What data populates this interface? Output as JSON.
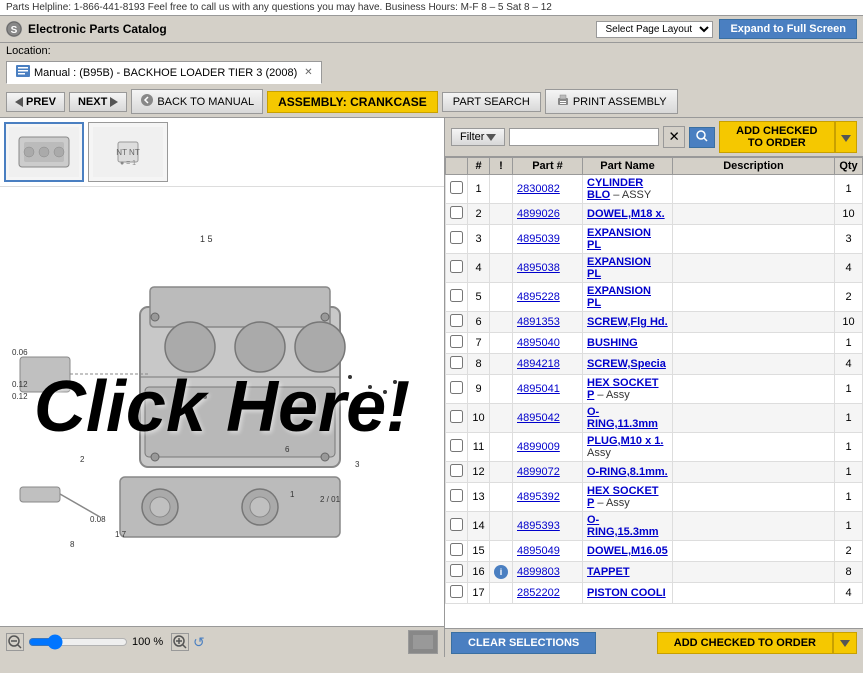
{
  "helpbar": {
    "text": "Parts Helpline: 1-866-441-8193 Feel free to call us with any questions you may have. Business Hours: M-F 8 – 5 Sat 8 – 12"
  },
  "titlebar": {
    "app_name": "Electronic Parts Catalog",
    "page_layout_label": "Select Page Layout",
    "expand_btn": "Expand to Full Screen"
  },
  "location": {
    "label": "Location:"
  },
  "tab": {
    "label": "Manual : (B95B) - BACKHOE LOADER TIER 3 (2008)"
  },
  "toolbar": {
    "prev_label": "PREV",
    "next_label": "NEXT",
    "back_label": "BACK TO MANUAL",
    "assembly_label": "ASSEMBLY: CRANKCASE",
    "part_search_label": "PART SEARCH",
    "print_label": "PRINT ASSEMBLY"
  },
  "filter": {
    "label": "Filter",
    "placeholder": "",
    "add_order_label": "ADD CHECKED TO ORDER"
  },
  "table": {
    "headers": [
      "",
      "#",
      "!",
      "Part #",
      "Part Name",
      "Description",
      "Qty"
    ],
    "rows": [
      {
        "num": "1",
        "flag": "",
        "part": "2830082",
        "name": "CYLINDER BLO",
        "name_suffix": "– ASSY",
        "desc": "",
        "qty": "1"
      },
      {
        "num": "2",
        "flag": "",
        "part": "4899026",
        "name": "DOWEL,M18 x.",
        "name_suffix": "",
        "desc": "",
        "qty": "10"
      },
      {
        "num": "3",
        "flag": "",
        "part": "4895039",
        "name": "EXPANSION PL",
        "name_suffix": "",
        "desc": "",
        "qty": "3"
      },
      {
        "num": "4",
        "flag": "",
        "part": "4895038",
        "name": "EXPANSION PL",
        "name_suffix": "",
        "desc": "",
        "qty": "4"
      },
      {
        "num": "5",
        "flag": "",
        "part": "4895228",
        "name": "EXPANSION PL",
        "name_suffix": "",
        "desc": "",
        "qty": "2"
      },
      {
        "num": "6",
        "flag": "",
        "part": "4891353",
        "name": "SCREW,Flg Hd.",
        "name_suffix": "",
        "desc": "",
        "qty": "10"
      },
      {
        "num": "7",
        "flag": "",
        "part": "4895040",
        "name": "BUSHING",
        "name_suffix": "",
        "desc": "",
        "qty": "1"
      },
      {
        "num": "8",
        "flag": "",
        "part": "4894218",
        "name": "SCREW,Specia",
        "name_suffix": "",
        "desc": "",
        "qty": "4"
      },
      {
        "num": "9",
        "flag": "",
        "part": "4895041",
        "name": "HEX SOCKET P",
        "name_suffix": "– Assy",
        "desc": "",
        "qty": "1"
      },
      {
        "num": "10",
        "flag": "",
        "part": "4895042",
        "name": "O-RING,11.3mm",
        "name_suffix": "",
        "desc": "",
        "qty": "1"
      },
      {
        "num": "11",
        "flag": "",
        "part": "4899009",
        "name": "PLUG,M10 x 1.",
        "name_suffix": "Assy",
        "desc": "",
        "qty": "1"
      },
      {
        "num": "12",
        "flag": "",
        "part": "4899072",
        "name": "O-RING,8.1mm.",
        "name_suffix": "",
        "desc": "",
        "qty": "1"
      },
      {
        "num": "13",
        "flag": "",
        "part": "4895392",
        "name": "HEX SOCKET P",
        "name_suffix": "– Assy",
        "desc": "",
        "qty": "1"
      },
      {
        "num": "14",
        "flag": "",
        "part": "4895393",
        "name": "O-RING,15.3mm",
        "name_suffix": "",
        "desc": "",
        "qty": "1"
      },
      {
        "num": "15",
        "flag": "",
        "part": "4895049",
        "name": "DOWEL,M16.05",
        "name_suffix": "",
        "desc": "",
        "qty": "2"
      },
      {
        "num": "16",
        "flag": "info",
        "part": "4899803",
        "name": "TAPPET",
        "name_suffix": "",
        "desc": "",
        "qty": "8"
      },
      {
        "num": "17",
        "flag": "",
        "part": "2852202",
        "name": "PISTON COOLI",
        "name_suffix": "",
        "desc": "",
        "qty": "4"
      }
    ]
  },
  "zoom": {
    "percent": "100 %"
  },
  "bottom": {
    "clear_label": "CLEAR SELECTIONS",
    "add_order_label": "ADD CHECKED TO ORDER"
  },
  "overlay": {
    "text": "Click Here!"
  }
}
